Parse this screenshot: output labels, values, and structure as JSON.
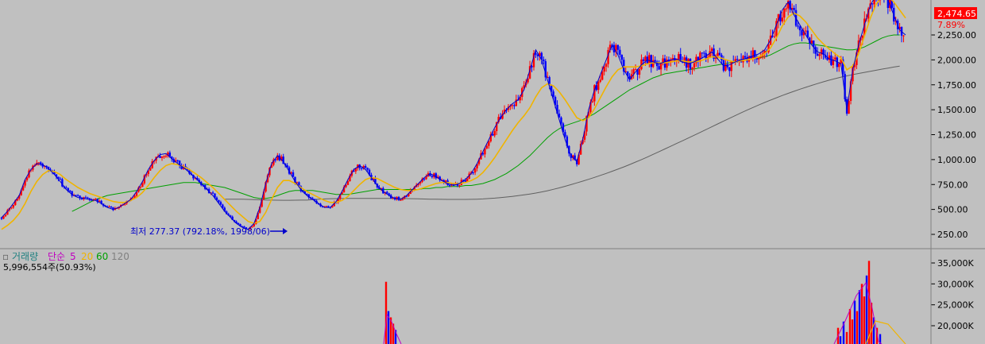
{
  "colors": {
    "background": "#c0c0c0",
    "up": "#ff0000",
    "down": "#0000ff",
    "ma5": "#0000cc",
    "ma20": "#f0b400",
    "ma60": "#00a000",
    "ma120": "#606060",
    "price_badge": "#ff0000",
    "annotation": "#0000cc"
  },
  "price_panel": {
    "current_price": "2,474.65",
    "change_pct": "7.89%",
    "low_annotation": "최저 277.37 (792.18%, 1998/06)"
  },
  "volume_panel": {
    "legend": {
      "marker": "▫",
      "title": "거래량",
      "type": "단순",
      "ma5": "5",
      "ma20": "20",
      "ma60": "60",
      "ma120": "120"
    },
    "summary": "5,996,554주(50.93%)"
  },
  "chart_data": [
    {
      "type": "candlestick",
      "title": "",
      "ylim": [
        100,
        2700
      ],
      "y_ticks": [
        "250.00",
        "500.00",
        "750.00",
        "1,000.00",
        "1,250.00",
        "1,500.00",
        "1,750.00",
        "2,000.00",
        "2,250.00"
      ],
      "y_tick_values": [
        250,
        500,
        750,
        1000,
        1250,
        1500,
        1750,
        2000,
        2250
      ],
      "series": [
        {
          "name": "5",
          "kind": "line",
          "values": [
            420,
            480,
            560,
            640,
            800,
            900,
            960,
            950,
            910,
            850,
            780,
            700,
            650,
            620,
            610,
            600,
            590,
            560,
            520,
            500,
            520,
            560,
            600,
            680,
            780,
            900,
            990,
            1050,
            1060,
            1010,
            960,
            920,
            870,
            820,
            760,
            700,
            640,
            560,
            480,
            420,
            360,
            320,
            300,
            360,
            520,
            760,
            960,
            1040,
            980,
            880,
            780,
            700,
            640,
            600,
            560,
            520,
            520,
            580,
            680,
            800,
            900,
            940,
            900,
            820,
            740,
            680,
            640,
            610,
            600,
            640,
            700,
            760,
            820,
            860,
            830,
            790,
            760,
            740,
            760,
            800,
            860,
            960,
            1080,
            1200,
            1320,
            1420,
            1500,
            1560,
            1600,
            1700,
            1900,
            2100,
            2000,
            1800,
            1600,
            1400,
            1200,
            1040,
            980,
            1200,
            1500,
            1700,
            1850,
            2000,
            2150,
            2050,
            1900,
            1800,
            1880,
            1950,
            2000,
            1980,
            1960,
            1980,
            2000,
            2010,
            1980,
            1960,
            1980,
            2010,
            2040,
            2080,
            2010,
            1940,
            1950,
            1980,
            2000,
            2020,
            2040,
            2060,
            2100,
            2200,
            2350,
            2500,
            2580,
            2450,
            2350,
            2250,
            2150,
            2080,
            2060,
            2010,
            1990,
            1960,
            1500,
            1900,
            2150,
            2350,
            2550,
            2650,
            2700,
            2600,
            2450,
            2300,
            2250
          ]
        },
        {
          "name": "20",
          "kind": "line",
          "values": [
            300,
            340,
            390,
            460,
            560,
            680,
            780,
            850,
            890,
            880,
            850,
            800,
            760,
            720,
            690,
            660,
            640,
            620,
            600,
            580,
            570,
            570,
            590,
            620,
            670,
            740,
            820,
            890,
            940,
            960,
            950,
            930,
            900,
            860,
            820,
            770,
            720,
            660,
            600,
            540,
            480,
            430,
            380,
            360,
            380,
            470,
            600,
            720,
            790,
            790,
            760,
            720,
            680,
            650,
            620,
            590,
            570,
            570,
            590,
            630,
            690,
            750,
            800,
            820,
            810,
            780,
            750,
            720,
            700,
            690,
            690,
            700,
            720,
            740,
            760,
            770,
            770,
            760,
            760,
            770,
            790,
            820,
            870,
            940,
            1020,
            1110,
            1200,
            1290,
            1370,
            1440,
            1520,
            1630,
            1720,
            1760,
            1740,
            1680,
            1600,
            1510,
            1420,
            1390,
            1420,
            1510,
            1620,
            1730,
            1830,
            1900,
            1930,
            1930,
            1930,
            1940,
            1960,
            1970,
            1970,
            1970,
            1980,
            1990,
            1990,
            1980,
            1980,
            1990,
            2010,
            2030,
            2030,
            2010,
            1990,
            1980,
            1990,
            2000,
            2010,
            2030,
            2060,
            2120,
            2220,
            2340,
            2430,
            2470,
            2440,
            2380,
            2300,
            2220,
            2160,
            2110,
            2060,
            2020,
            1900,
            1940,
            2060,
            2240,
            2420,
            2560,
            2640,
            2640,
            2580,
            2500,
            2420
          ]
        },
        {
          "name": "60",
          "kind": "line",
          "values": [
            null,
            null,
            null,
            null,
            null,
            null,
            null,
            null,
            null,
            null,
            null,
            null,
            480,
            510,
            540,
            570,
            600,
            620,
            640,
            650,
            660,
            670,
            680,
            690,
            700,
            710,
            720,
            730,
            740,
            750,
            760,
            770,
            770,
            770,
            760,
            750,
            740,
            730,
            720,
            700,
            680,
            660,
            640,
            620,
            610,
            610,
            620,
            640,
            660,
            680,
            690,
            690,
            690,
            690,
            680,
            670,
            660,
            650,
            650,
            650,
            660,
            670,
            680,
            690,
            700,
            700,
            700,
            700,
            700,
            700,
            700,
            700,
            710,
            710,
            720,
            720,
            730,
            730,
            730,
            740,
            740,
            750,
            760,
            780,
            800,
            830,
            860,
            900,
            940,
            990,
            1040,
            1100,
            1160,
            1220,
            1270,
            1310,
            1340,
            1360,
            1380,
            1400,
            1430,
            1460,
            1500,
            1540,
            1580,
            1620,
            1660,
            1700,
            1730,
            1760,
            1790,
            1820,
            1840,
            1860,
            1870,
            1880,
            1890,
            1900,
            1910,
            1920,
            1930,
            1940,
            1950,
            1960,
            1970,
            1980,
            1990,
            2000,
            2010,
            2020,
            2030,
            2050,
            2080,
            2110,
            2140,
            2160,
            2170,
            2170,
            2160,
            2150,
            2140,
            2130,
            2120,
            2110,
            2100,
            2100,
            2110,
            2130,
            2160,
            2190,
            2220,
            2240,
            2250,
            2250
          ]
        },
        {
          "name": "120",
          "kind": "line",
          "values": [
            null,
            null,
            null,
            null,
            null,
            null,
            null,
            null,
            null,
            null,
            null,
            null,
            null,
            null,
            null,
            null,
            null,
            null,
            null,
            null,
            null,
            null,
            null,
            null,
            null,
            null,
            null,
            null,
            null,
            null,
            null,
            null,
            null,
            null,
            null,
            null,
            null,
            null,
            null,
            null,
            null,
            null,
            null,
            null,
            null,
            null,
            null,
            null,
            null,
            null,
            null,
            null,
            null,
            null,
            null,
            null,
            null,
            null,
            null,
            null,
            null,
            null,
            null,
            null,
            null,
            null,
            null,
            null,
            null,
            null,
            null,
            null,
            null,
            null,
            null,
            null,
            null,
            null,
            null,
            null,
            null,
            null,
            null,
            null,
            null,
            null,
            null,
            null,
            null,
            null,
            null,
            null,
            null,
            null,
            null,
            null,
            null,
            null,
            null,
            null,
            null,
            null,
            null,
            null,
            null,
            null,
            null,
            null,
            null,
            null,
            null,
            null,
            null,
            null,
            null,
            null,
            null,
            null,
            null,
            null,
            null,
            null,
            null,
            null,
            null,
            null,
            null,
            null,
            null,
            null,
            null,
            null,
            null,
            null,
            null,
            null,
            null,
            null,
            null,
            null,
            null,
            null,
            null,
            null,
            null,
            null,
            null,
            null,
            null,
            null,
            null,
            null,
            null,
            null,
            null,
            null,
            null,
            null,
            null,
            null
          ]
        }
      ]
    },
    {
      "type": "bar",
      "title": "",
      "ylim": [
        0,
        37000
      ],
      "y_ticks": [
        "20,000K",
        "25,000K",
        "30,000K",
        "35,000K"
      ],
      "y_tick_values": [
        20000,
        25000,
        30000,
        35000
      ]
    }
  ]
}
